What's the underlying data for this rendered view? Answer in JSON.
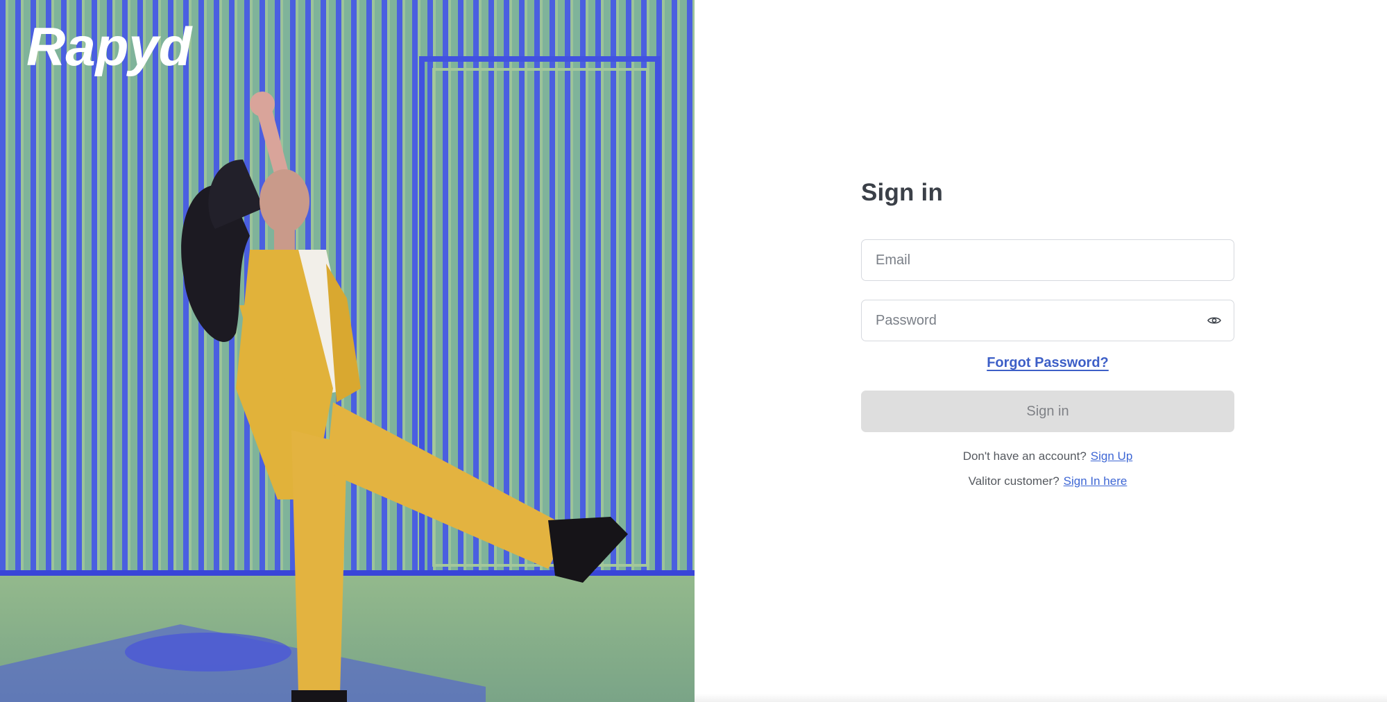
{
  "brand": {
    "logo_text": "Rapyd"
  },
  "hero": {
    "image": "woman in yellow suit kicking in front of blue corrugated wall"
  },
  "form": {
    "title": "Sign in",
    "email_placeholder": "Email",
    "email_value": "",
    "password_placeholder": "Password",
    "password_value": "",
    "password_toggle_icon": "eye-icon",
    "forgot_label": "Forgot Password?",
    "submit_label": "Sign in",
    "signup_prompt": "Don't have an account?",
    "signup_link": "Sign Up",
    "valitor_prompt": "Valitor customer?",
    "valitor_link": "Sign In here"
  },
  "colors": {
    "accent": "#3d5fc7",
    "button_disabled_bg": "#dedede",
    "title": "#3b4048"
  }
}
